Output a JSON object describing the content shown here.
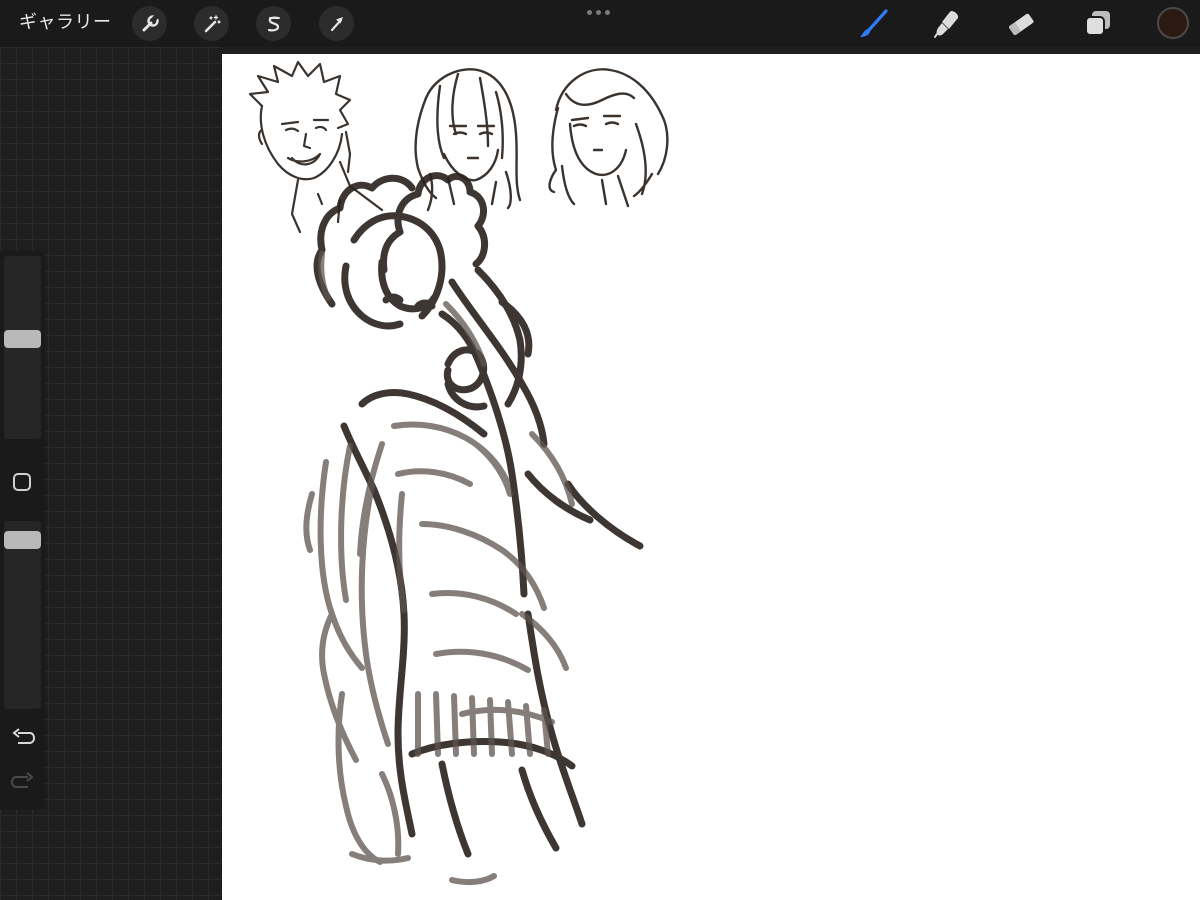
{
  "topbar": {
    "gallery_label": "ギャラリー",
    "actions_icon": "wrench-icon",
    "adjustments_icon": "magic-wand-icon",
    "selection_icon": "selection-s-icon",
    "transform_icon": "arrow-cursor-icon",
    "brush_icon": "paintbrush-icon",
    "smudge_icon": "smudge-finger-icon",
    "eraser_icon": "eraser-icon",
    "layers_icon": "layers-icon",
    "current_color": "#2a1a12",
    "active_tool_color": "#2f7cf6"
  },
  "sidebar": {
    "brush_size_level": 0.55,
    "opacity_level": 0.94,
    "modify_icon": "square-icon",
    "undo_icon": "undo-arrow-icon",
    "redo_icon": "redo-arrow-icon"
  },
  "canvas": {
    "background": "#ffffff",
    "stroke_color": "#2a211c"
  }
}
